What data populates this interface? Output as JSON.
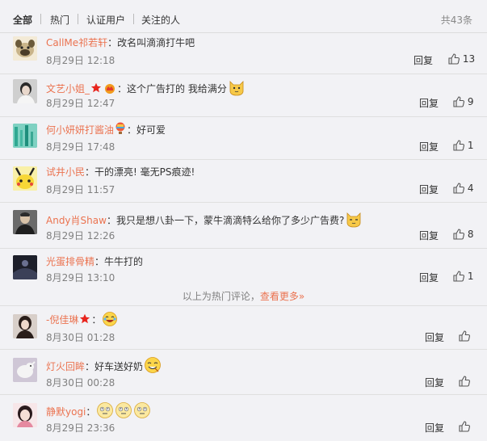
{
  "tabs": {
    "all": "全部",
    "hot": "热门",
    "verified": "认证用户",
    "following": "关注的人",
    "total": "共43条"
  },
  "comments": [
    {
      "user": "CallMe祁若轩",
      "text": "改名叫滴滴打牛吧",
      "time": "8月29日 12:18",
      "reply": "回复",
      "likes": "13"
    },
    {
      "user": "文艺小姐_",
      "text": "这个广告打的 我给满分",
      "time": "8月29日 12:47",
      "reply": "回复",
      "likes": "9"
    },
    {
      "user": "何小妍妍打酱油",
      "text": "好可爱",
      "time": "8月29日 17:48",
      "reply": "回复",
      "likes": "1"
    },
    {
      "user": "试井小民",
      "text": "干的漂亮! 毫无PS痕迹!",
      "time": "8月29日 11:57",
      "reply": "回复",
      "likes": "4"
    },
    {
      "user": "Andy肖Shaw",
      "text": "我只是想八卦一下，蒙牛滴滴特么给你了多少广告费?",
      "time": "8月29日 12:26",
      "reply": "回复",
      "likes": "8"
    },
    {
      "user": "光蛋排骨精",
      "text": "牛牛打的",
      "time": "8月29日 13:10",
      "reply": "回复",
      "likes": "1"
    },
    {
      "user": "-倪佳琳",
      "text": "",
      "time": "8月30日 01:28",
      "reply": "回复",
      "likes": ""
    },
    {
      "user": "灯火回眸",
      "text": "好车送好奶",
      "time": "8月30日 00:28",
      "reply": "回复",
      "likes": ""
    },
    {
      "user": "静默yogi",
      "text": "",
      "time": "8月29日 23:36",
      "reply": "回复",
      "likes": ""
    }
  ],
  "hot_divider": {
    "text": "以上为热门评论，",
    "link": "查看更多»"
  },
  "colors": {
    "username": "#eb7350",
    "time": "#808080",
    "background": "#f2f2f5"
  }
}
